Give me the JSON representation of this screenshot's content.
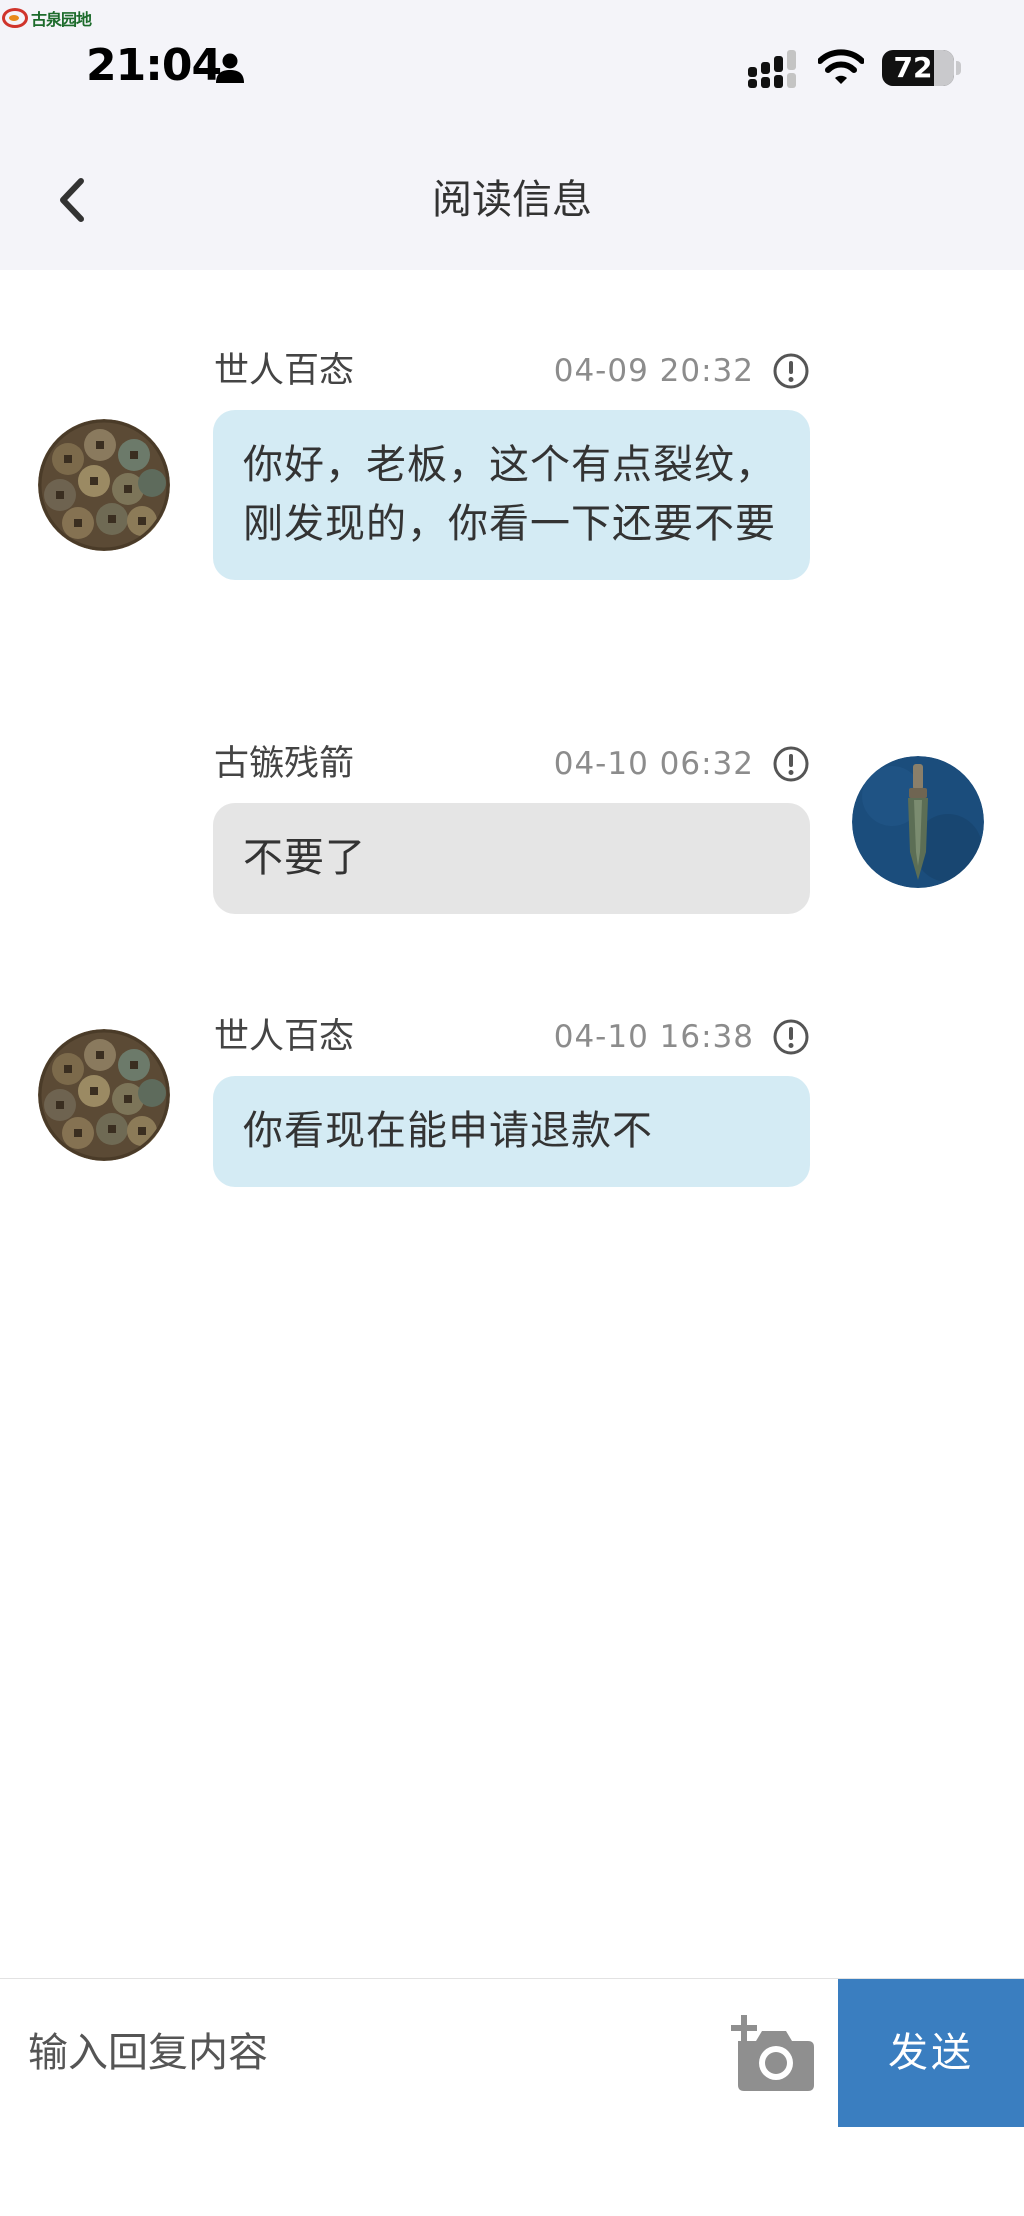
{
  "watermark": {
    "text": "古泉园地"
  },
  "status_bar": {
    "time": "21:04",
    "battery_percent": "72",
    "battery_level": 0.72,
    "icons": [
      "person-icon",
      "cellular-signal-icon",
      "wifi-icon",
      "battery-icon"
    ]
  },
  "nav": {
    "title": "阅读信息",
    "back_icon": "chevron-left-icon"
  },
  "messages": [
    {
      "sender": "世人百态",
      "time": "04-09 20:32",
      "text": "你好，老板，这个有点裂纹，刚发现的，你看一下还要不要",
      "side": "left",
      "avatar": "coins-avatar"
    },
    {
      "sender": "古镞残箭",
      "time": "04-10 06:32",
      "text": "不要了",
      "side": "right",
      "avatar": "arrowhead-avatar"
    },
    {
      "sender": "世人百态",
      "time": "04-10 16:38",
      "text": "你看现在能申请退款不",
      "side": "left",
      "avatar": "coins-avatar"
    }
  ],
  "reply": {
    "placeholder": "输入回复内容",
    "camera_icon": "camera-add-icon",
    "send_label": "发送"
  },
  "colors": {
    "header_bg": "#f4f4f9",
    "bubble_received": "#d4ebf4",
    "bubble_sent": "#e5e5e5",
    "send_button": "#3a7ec0",
    "timestamp": "#8c8c8c"
  }
}
